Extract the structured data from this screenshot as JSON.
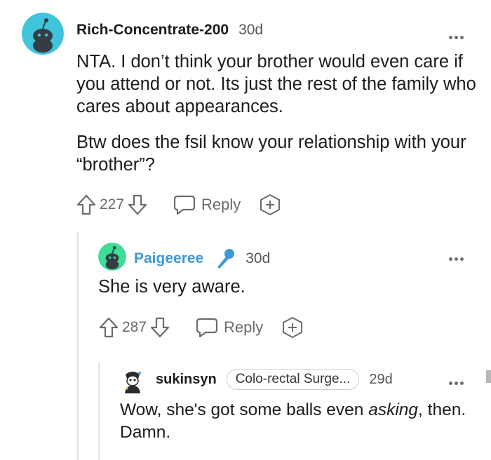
{
  "comments": [
    {
      "username": "Rich-Concentrate-200",
      "age": "30d",
      "body": [
        "NTA. I don’t think your brother would even care if you attend or not. Its just the rest of the family who cares about appearances.",
        "Btw does the fsil know your relationship with your “brother”?"
      ],
      "votes": "227",
      "reply_label": "Reply",
      "avatar_color": "#40c4dc"
    },
    {
      "username": "Paigeeree",
      "age": "30d",
      "badge_icon": "microphone-icon",
      "body": [
        "She is very aware."
      ],
      "votes": "287",
      "reply_label": "Reply",
      "avatar_color": "#3ddc97",
      "username_color": "#3d9ad6"
    },
    {
      "username": "sukinsyn",
      "flair": "Colo-rectal Surge...",
      "age": "29d",
      "body_before": "Wow, she's got some balls even ",
      "body_emphasis": "asking",
      "body_after": ", then. Damn."
    }
  ]
}
